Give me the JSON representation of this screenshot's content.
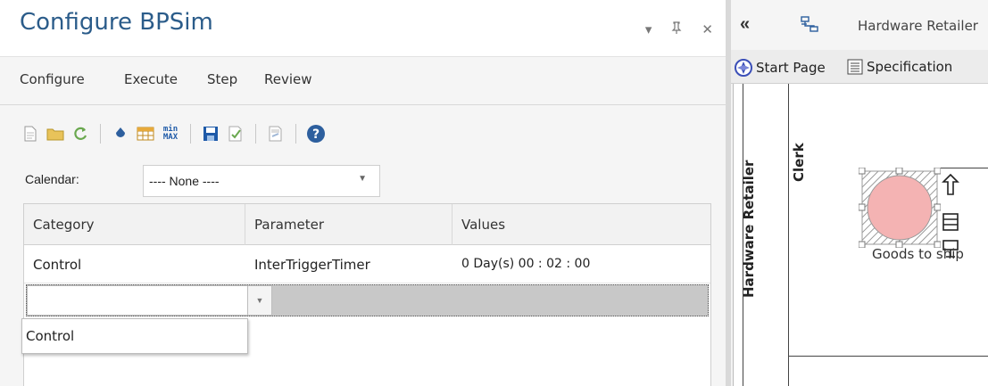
{
  "panel": {
    "title": "Configure BPSim",
    "controls": {
      "dropdown": "▾",
      "pin": "ᵖ",
      "close": "✕"
    }
  },
  "tabs": [
    {
      "label": "Configure"
    },
    {
      "label": "Execute"
    },
    {
      "label": "Step"
    },
    {
      "label": "Review"
    }
  ],
  "toolbar": {
    "icons": [
      "new-document-icon",
      "open-folder-icon",
      "refresh-icon",
      "bucket-icon",
      "table-icon",
      "min-max-icon",
      "save-icon",
      "validate-icon",
      "xml-export-icon",
      "help-icon"
    ],
    "min_top": "min",
    "min_bottom": "MAX"
  },
  "calendar": {
    "label": "Calendar:",
    "selected": "---- None ----"
  },
  "grid": {
    "columns": [
      "Category",
      "Parameter",
      "Values"
    ],
    "rows": [
      {
        "category": "Control",
        "parameter": "InterTriggerTimer",
        "values": "0 Day(s) 00 : 02 : 00"
      }
    ],
    "edit_value": "",
    "dropdown_options": [
      "Control"
    ]
  },
  "diagram": {
    "title": "Hardware Retailer",
    "tabs": [
      "Start Page",
      "Specification"
    ],
    "lane_outer": "Hardware Retailer",
    "lane_inner": "Clerk",
    "element_label": "Goods to ship",
    "element_fill": "#f4b3b3"
  },
  "colors": {
    "title": "#2b5c8a",
    "accent_blue": "#1e5aa8"
  }
}
